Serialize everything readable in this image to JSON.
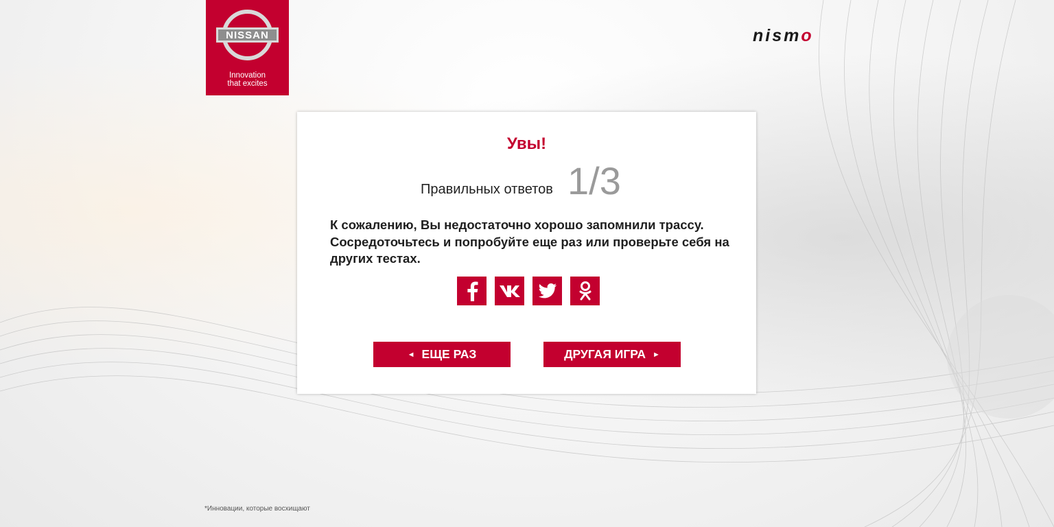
{
  "brand": {
    "logo_text": "NISSAN",
    "tagline_line1": "Innovation",
    "tagline_line2": "that excites",
    "nismo_left": "nism",
    "nismo_right": "o"
  },
  "result": {
    "title": "Увы!",
    "score_label": "Правильных ответов",
    "score_value": "1/3",
    "message": "К сожалению, Вы недостаточно хорошо запомнили трассу. Сосредоточьтесь и попробуйте еще раз или проверьте себя на других тестах."
  },
  "share": {
    "items": [
      {
        "icon": "facebook-icon"
      },
      {
        "icon": "vk-icon"
      },
      {
        "icon": "twitter-icon"
      },
      {
        "icon": "odnoklassniki-icon"
      }
    ]
  },
  "actions": {
    "retry_label": "ЕЩЕ РАЗ",
    "retry_arrow": "◄",
    "other_game_label": "ДРУГАЯ ИГРА",
    "other_game_arrow": "►"
  },
  "footer": {
    "note": "*Инновации, которые восхищают"
  },
  "colors": {
    "accent": "#c3002f",
    "score_gray": "#9a9a9a"
  }
}
